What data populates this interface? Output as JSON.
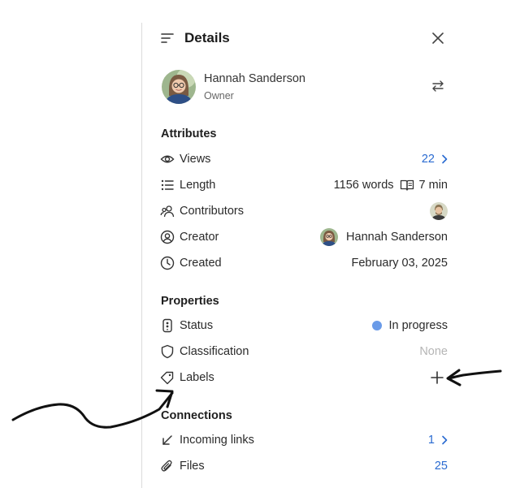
{
  "header": {
    "title": "Details"
  },
  "owner": {
    "name": "Hannah Sanderson",
    "role": "Owner"
  },
  "attributes": {
    "title": "Attributes",
    "views": {
      "label": "Views",
      "value": "22"
    },
    "length": {
      "label": "Length",
      "words": "1156 words",
      "time": "7 min"
    },
    "contributors": {
      "label": "Contributors"
    },
    "creator": {
      "label": "Creator",
      "name": "Hannah Sanderson"
    },
    "created": {
      "label": "Created",
      "date": "February 03, 2025"
    }
  },
  "properties": {
    "title": "Properties",
    "status": {
      "label": "Status",
      "value": "In progress",
      "color": "#6a9be8"
    },
    "classification": {
      "label": "Classification",
      "value": "None"
    },
    "labels": {
      "label": "Labels"
    }
  },
  "connections": {
    "title": "Connections",
    "incoming": {
      "label": "Incoming links",
      "value": "1"
    },
    "files": {
      "label": "Files",
      "value": "25"
    }
  },
  "colors": {
    "accent": "#2a6bd1",
    "divider": "#dcdcdc",
    "muted": "#b5b5b5"
  }
}
